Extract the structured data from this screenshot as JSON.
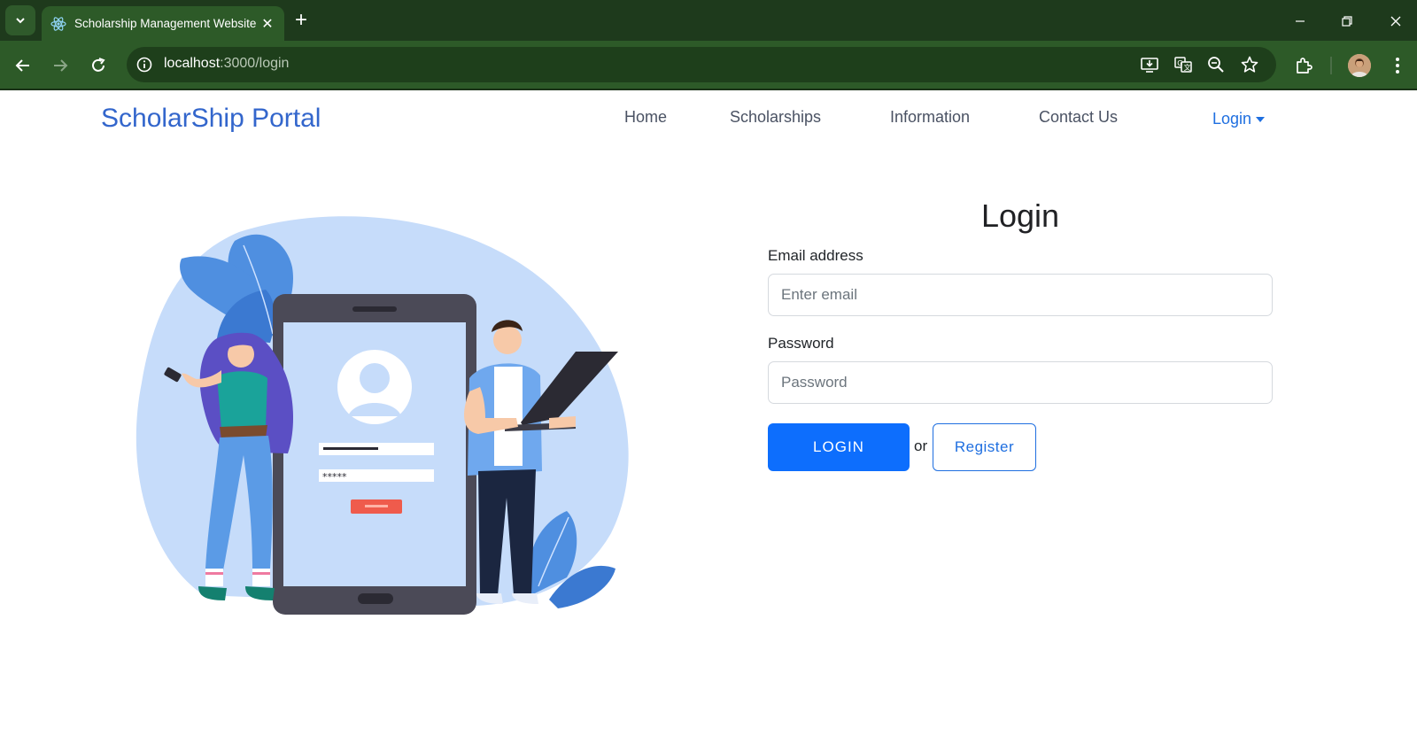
{
  "browser": {
    "tab_title": "Scholarship Management Website",
    "url_host": "localhost",
    "url_path": ":3000/login",
    "icons": [
      "tab-search-icon",
      "react-favicon-icon",
      "close-icon",
      "new-tab-icon",
      "minimize-icon",
      "restore-icon",
      "window-close-icon",
      "back-icon",
      "forward-icon",
      "reload-icon",
      "site-info-icon",
      "install-app-icon",
      "translate-icon",
      "zoom-icon",
      "bookmark-star-icon",
      "extensions-icon",
      "profile-avatar",
      "menu-dots-icon"
    ],
    "colors": {
      "tabbar": "#1e3a1c",
      "toolbar": "#2d5a28"
    }
  },
  "navbar": {
    "brand": "ScholarShip Portal",
    "links": [
      "Home",
      "Scholarships",
      "Information",
      "Contact Us"
    ],
    "login_dropdown": "Login",
    "colors": {
      "brand": "#3366cc",
      "link": "#4a5263",
      "accent": "#1f6fe0"
    }
  },
  "illustration": {
    "login_button_masked": "*****"
  },
  "login_form": {
    "title": "Login",
    "email_label": "Email address",
    "email_placeholder": "Enter email",
    "email_value": "",
    "password_label": "Password",
    "password_placeholder": "Password",
    "password_value": "",
    "login_button": "LOGIN",
    "or_text": "or",
    "register_button": "Register",
    "colors": {
      "primary": "#0d6efd"
    }
  }
}
